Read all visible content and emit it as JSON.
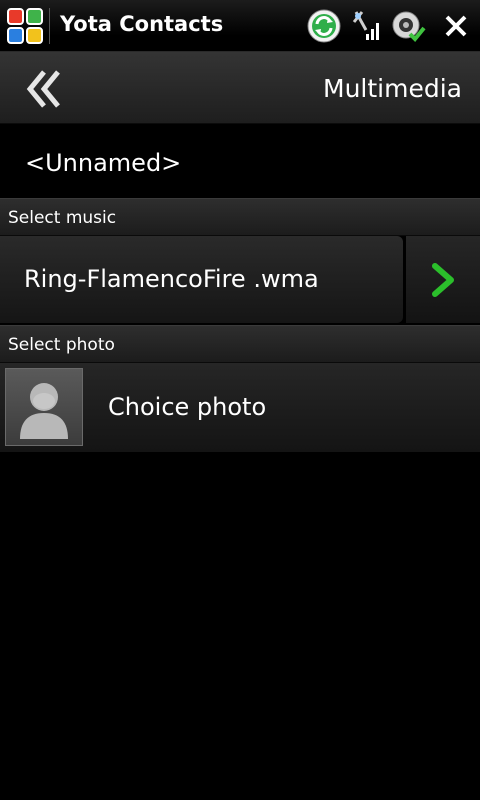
{
  "statusbar": {
    "app_title": "Yota Contacts",
    "icons": [
      "windows-start-icon",
      "sync-icon",
      "signal-icon",
      "connection-icon",
      "close-icon"
    ]
  },
  "header": {
    "back_icon": "double-chevron-left-icon",
    "title": "Multimedia"
  },
  "contact": {
    "name": "<Unnamed>"
  },
  "music": {
    "section_label": "Select music",
    "selected_track": "Ring-FlamencoFire .wma",
    "play_icon": "play-icon"
  },
  "photo": {
    "section_label": "Select photo",
    "choice_label": "Choice photo",
    "avatar_icon": "person-silhouette-icon"
  },
  "colors": {
    "background": "#000000",
    "accent_green": "#2bbf2b",
    "text": "#ffffff"
  }
}
